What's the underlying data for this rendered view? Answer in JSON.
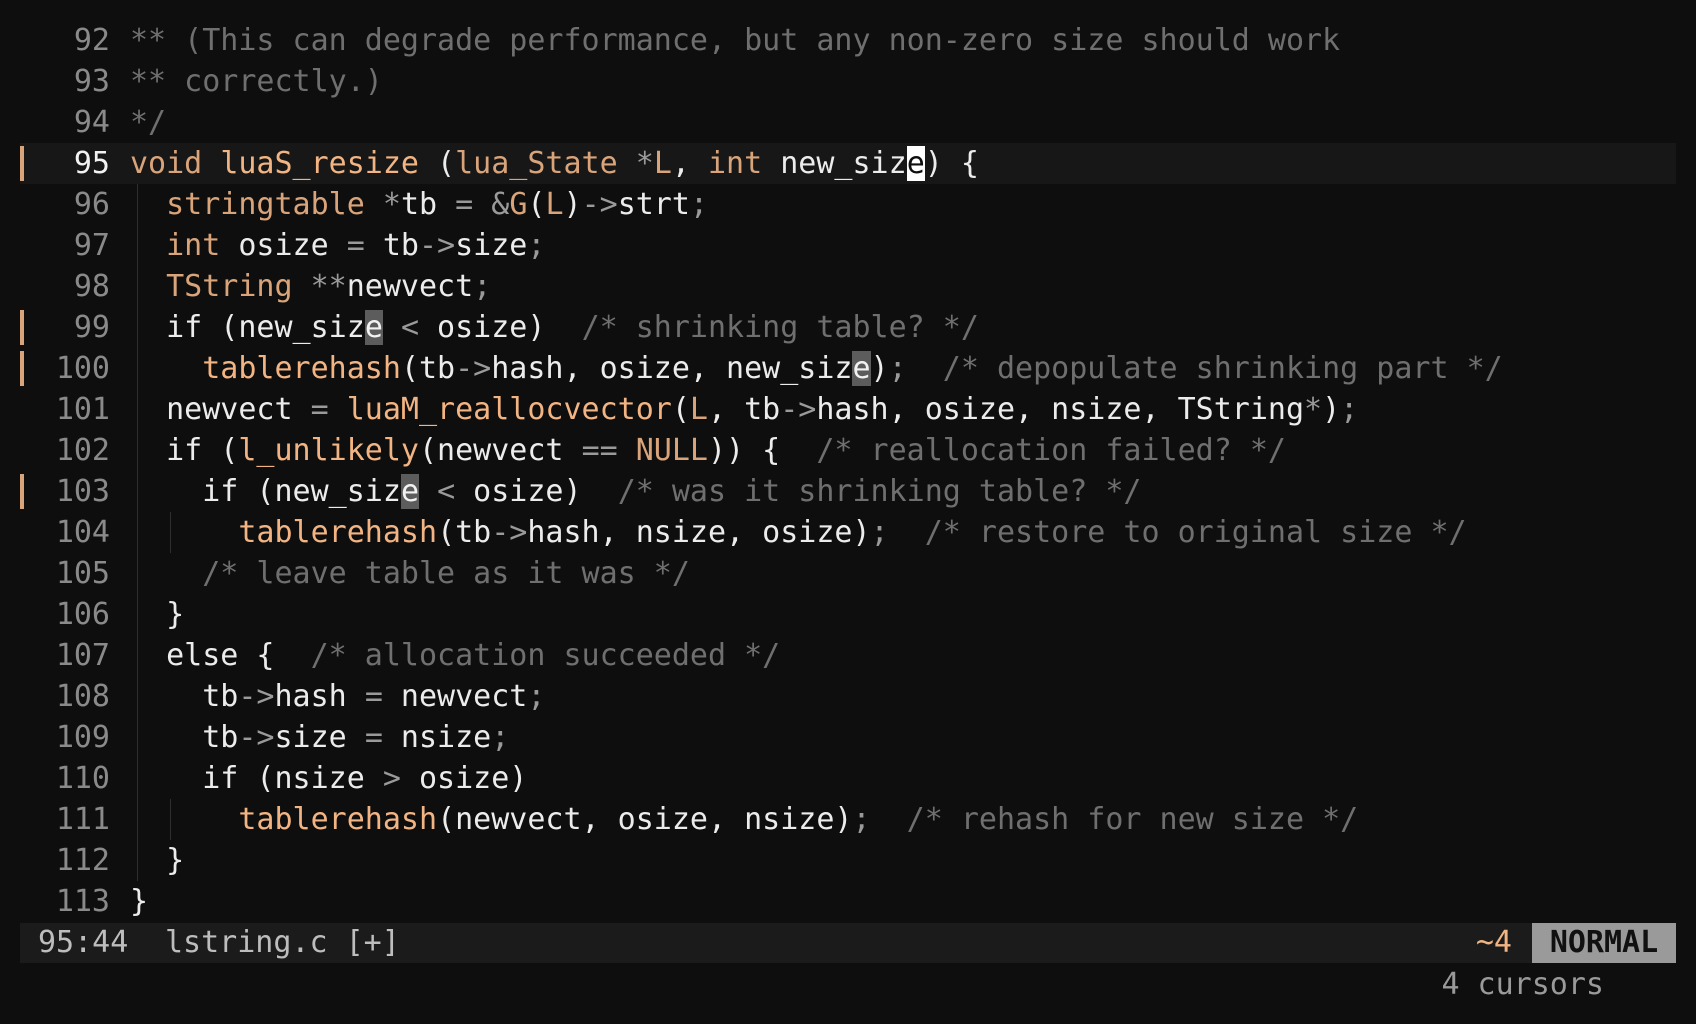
{
  "editor": {
    "lines": [
      {
        "n": "92",
        "gutter": false,
        "current": false,
        "guides": [],
        "tokens": [
          [
            "cm",
            "** (This can degrade performance, but any non-zero size should work"
          ]
        ]
      },
      {
        "n": "93",
        "gutter": false,
        "current": false,
        "guides": [],
        "tokens": [
          [
            "cm",
            "** correctly.)"
          ]
        ]
      },
      {
        "n": "94",
        "gutter": false,
        "current": false,
        "guides": [],
        "tokens": [
          [
            "cm",
            "*/"
          ]
        ]
      },
      {
        "n": "95",
        "gutter": true,
        "current": true,
        "guides": [],
        "tokens": [
          [
            "kw",
            "void"
          ],
          [
            "pl",
            " "
          ],
          [
            "fn",
            "luaS_resize"
          ],
          [
            "pl",
            " ("
          ],
          [
            "kw",
            "lua_State"
          ],
          [
            "pl",
            " "
          ],
          [
            "op",
            "*"
          ],
          [
            "kw",
            "L"
          ],
          [
            "pl",
            ", "
          ],
          [
            "kw",
            "int"
          ],
          [
            "pl",
            " new_siz"
          ],
          [
            "cur-pri",
            "e"
          ],
          [
            "pl",
            ") {"
          ]
        ]
      },
      {
        "n": "96",
        "gutter": false,
        "current": false,
        "guides": [
          1
        ],
        "tokens": [
          [
            "pl",
            "  "
          ],
          [
            "kw",
            "stringtable"
          ],
          [
            "pl",
            " "
          ],
          [
            "op",
            "*"
          ],
          [
            "pl",
            "tb "
          ],
          [
            "op",
            "="
          ],
          [
            "pl",
            " "
          ],
          [
            "op",
            "&"
          ],
          [
            "kw",
            "G"
          ],
          [
            "pl",
            "("
          ],
          [
            "kw",
            "L"
          ],
          [
            "pl",
            ")"
          ],
          [
            "op",
            "->"
          ],
          [
            "pl",
            "strt"
          ],
          [
            "op",
            ";"
          ]
        ]
      },
      {
        "n": "97",
        "gutter": false,
        "current": false,
        "guides": [
          1
        ],
        "tokens": [
          [
            "pl",
            "  "
          ],
          [
            "kw",
            "int"
          ],
          [
            "pl",
            " osize "
          ],
          [
            "op",
            "="
          ],
          [
            "pl",
            " tb"
          ],
          [
            "op",
            "->"
          ],
          [
            "pl",
            "size"
          ],
          [
            "op",
            ";"
          ]
        ]
      },
      {
        "n": "98",
        "gutter": false,
        "current": false,
        "guides": [
          1
        ],
        "tokens": [
          [
            "pl",
            "  "
          ],
          [
            "kw",
            "TString"
          ],
          [
            "pl",
            " "
          ],
          [
            "op",
            "**"
          ],
          [
            "pl",
            "newvect"
          ],
          [
            "op",
            ";"
          ]
        ]
      },
      {
        "n": "99",
        "gutter": true,
        "current": false,
        "guides": [
          1
        ],
        "tokens": [
          [
            "pl",
            "  if (new_siz"
          ],
          [
            "cur-sec",
            "e"
          ],
          [
            "pl",
            " "
          ],
          [
            "op",
            "<"
          ],
          [
            "pl",
            " osize)  "
          ],
          [
            "cm",
            "/* shrinking table? */"
          ]
        ]
      },
      {
        "n": "100",
        "gutter": true,
        "current": false,
        "guides": [
          1
        ],
        "tokens": [
          [
            "pl",
            "    "
          ],
          [
            "fn",
            "tablerehash"
          ],
          [
            "pl",
            "(tb"
          ],
          [
            "op",
            "->"
          ],
          [
            "pl",
            "hash, osize, new_siz"
          ],
          [
            "cur-sec",
            "e"
          ],
          [
            "pl",
            ")"
          ],
          [
            "op",
            ";"
          ],
          [
            "pl",
            "  "
          ],
          [
            "cm",
            "/* depopulate shrinking part */"
          ]
        ]
      },
      {
        "n": "101",
        "gutter": false,
        "current": false,
        "guides": [
          1
        ],
        "tokens": [
          [
            "pl",
            "  newvect "
          ],
          [
            "op",
            "="
          ],
          [
            "pl",
            " "
          ],
          [
            "fn",
            "luaM_reallocvector"
          ],
          [
            "pl",
            "("
          ],
          [
            "kw",
            "L"
          ],
          [
            "pl",
            ", tb"
          ],
          [
            "op",
            "->"
          ],
          [
            "pl",
            "hash, osize, nsize, TString"
          ],
          [
            "op",
            "*"
          ],
          [
            "pl",
            ")"
          ],
          [
            "op",
            ";"
          ]
        ]
      },
      {
        "n": "102",
        "gutter": false,
        "current": false,
        "guides": [
          1
        ],
        "tokens": [
          [
            "pl",
            "  if ("
          ],
          [
            "fn",
            "l_unlikely"
          ],
          [
            "pl",
            "(newvect "
          ],
          [
            "op",
            "=="
          ],
          [
            "pl",
            " "
          ],
          [
            "kw",
            "NULL"
          ],
          [
            "pl",
            ")) {  "
          ],
          [
            "cm",
            "/* reallocation failed? */"
          ]
        ]
      },
      {
        "n": "103",
        "gutter": true,
        "current": false,
        "guides": [
          1
        ],
        "tokens": [
          [
            "pl",
            "    if (new_siz"
          ],
          [
            "cur-sec",
            "e"
          ],
          [
            "pl",
            " "
          ],
          [
            "op",
            "<"
          ],
          [
            "pl",
            " osize)  "
          ],
          [
            "cm",
            "/* was it shrinking table? */"
          ]
        ]
      },
      {
        "n": "104",
        "gutter": false,
        "current": false,
        "guides": [
          1,
          3
        ],
        "tokens": [
          [
            "pl",
            "      "
          ],
          [
            "fn",
            "tablerehash"
          ],
          [
            "pl",
            "(tb"
          ],
          [
            "op",
            "->"
          ],
          [
            "pl",
            "hash, nsize, osize)"
          ],
          [
            "op",
            ";"
          ],
          [
            "pl",
            "  "
          ],
          [
            "cm",
            "/* restore to original size */"
          ]
        ]
      },
      {
        "n": "105",
        "gutter": false,
        "current": false,
        "guides": [
          1
        ],
        "tokens": [
          [
            "pl",
            "    "
          ],
          [
            "cm",
            "/* leave table as it was */"
          ]
        ]
      },
      {
        "n": "106",
        "gutter": false,
        "current": false,
        "guides": [
          1
        ],
        "tokens": [
          [
            "pl",
            "  }"
          ]
        ]
      },
      {
        "n": "107",
        "gutter": false,
        "current": false,
        "guides": [
          1
        ],
        "tokens": [
          [
            "pl",
            "  else {  "
          ],
          [
            "cm",
            "/* allocation succeeded */"
          ]
        ]
      },
      {
        "n": "108",
        "gutter": false,
        "current": false,
        "guides": [
          1
        ],
        "tokens": [
          [
            "pl",
            "    tb"
          ],
          [
            "op",
            "->"
          ],
          [
            "pl",
            "hash "
          ],
          [
            "op",
            "="
          ],
          [
            "pl",
            " newvect"
          ],
          [
            "op",
            ";"
          ]
        ]
      },
      {
        "n": "109",
        "gutter": false,
        "current": false,
        "guides": [
          1
        ],
        "tokens": [
          [
            "pl",
            "    tb"
          ],
          [
            "op",
            "->"
          ],
          [
            "pl",
            "size "
          ],
          [
            "op",
            "="
          ],
          [
            "pl",
            " nsize"
          ],
          [
            "op",
            ";"
          ]
        ]
      },
      {
        "n": "110",
        "gutter": false,
        "current": false,
        "guides": [
          1
        ],
        "tokens": [
          [
            "pl",
            "    if (nsize "
          ],
          [
            "op",
            ">"
          ],
          [
            "pl",
            " osize)"
          ]
        ]
      },
      {
        "n": "111",
        "gutter": false,
        "current": false,
        "guides": [
          1,
          3
        ],
        "tokens": [
          [
            "pl",
            "      "
          ],
          [
            "fn",
            "tablerehash"
          ],
          [
            "pl",
            "(newvect, osize, nsize)"
          ],
          [
            "op",
            ";"
          ],
          [
            "pl",
            "  "
          ],
          [
            "cm",
            "/* rehash for new size */"
          ]
        ]
      },
      {
        "n": "112",
        "gutter": false,
        "current": false,
        "guides": [
          1
        ],
        "tokens": [
          [
            "pl",
            "  }"
          ]
        ]
      },
      {
        "n": "113",
        "gutter": false,
        "current": false,
        "guides": [],
        "tokens": [
          [
            "pl",
            "}"
          ]
        ]
      }
    ]
  },
  "statusbar": {
    "position": "95:44",
    "file": "lstring.c [+]",
    "cursor_count": "~4",
    "mode": "NORMAL"
  },
  "message": "4 cursors",
  "colors": {
    "background": "#0e0e0e",
    "accent": "#d9a479",
    "mode_badge": "#9a9a9a"
  }
}
